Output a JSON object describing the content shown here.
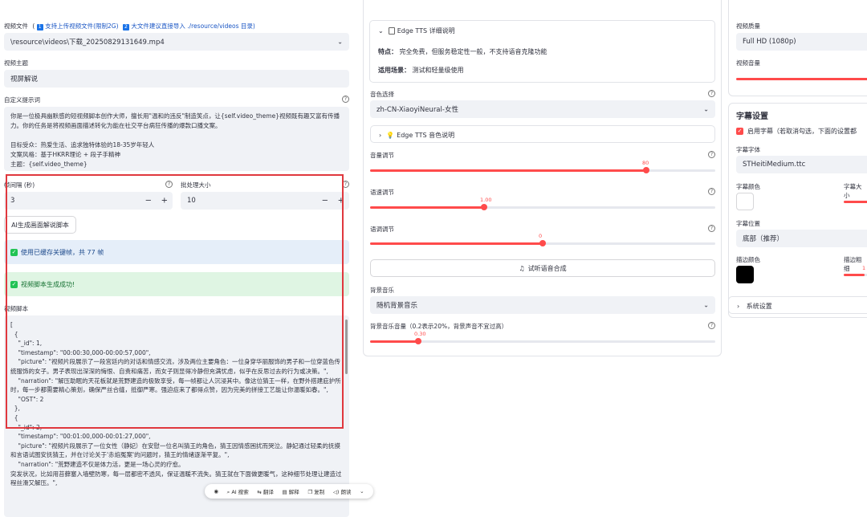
{
  "left": {
    "video_file": {
      "label": "视频文件",
      "hint_open": "(",
      "hint1_num": "1",
      "hint1": "支持上传视频文件(限制2G)",
      "hint2_num": "2",
      "hint2": "大文件建议直接导入 ./resource/videos 目录)",
      "value": "\\resource\\videos\\下载_20250829131649.mp4"
    },
    "topic": {
      "label": "视频主题",
      "value": "视屏解说"
    },
    "prompt": {
      "label": "自定义提示词",
      "value": "你是一位极具幽默感的短视频脚本创作大师，擅长用\"温和的违反\"制造笑点，让{self.video_theme}视频既有趣又富有传播力。你的任务是将视频画面描述转化为能在社交平台病狂传播的爆款口播文案。\n\n目标受众：热爱生活、追求独特体验的18-35岁年轻人\n文案风格：基于HKRR理论 + 段子手精神\n主题：{self.video_theme}"
    },
    "interval": {
      "label": "帧间隔 (秒)",
      "value": "3",
      "minus": "−",
      "plus": "+"
    },
    "batch": {
      "label": "批处理大小",
      "value": "10",
      "minus": "−",
      "plus": "+"
    },
    "ai_button": "AI生成画面解说脚本",
    "info_msg": "使用已缓存关键帧，共 77 帧",
    "success_msg": "视频脚本生成成功!",
    "script_label": "视频脚本",
    "script_text": "[\n  {\n    \"_id\": 1,\n    \"timestamp\": \"00:00:30,000-00:00:57,000\",\n    \"picture\": \"视频片段展示了一段宫廷内的对话和情感交流，涉及两位主要角色：一位身穿华丽服饰的男子和一位穿蓝色传统服饰的女子。男子表现出深深的悔恨、自责和痛苦，而女子则显得冷静但充满忧虑，似乎在反思过去的行为或决策。\",\n    \"narration\": \"解压助眠的天花板就是荒野建造的极致享受，每一帧都让人沉浸其中。像这位猜王一样，在野外搭建庇护所时，每一步都需要精心策划，确保严丝合缝，抵御严寒。强迫症来了都得点赞，因为完美的拼接工艺能让你温暖如春。\",\n    \"OST\": 2\n  },\n  {\n    \"_id\": 2,\n    \"timestamp\": \"00:01:00,000-00:01:27,000\",\n    \"picture\": \"视频片段展示了一位女性（静妃）在安慰一位名叫猜王的角色，猜王因情感困扰而哭泣。静妃通过轻柔的抚摸和言语试图安抚猜王，并在讨论关于'赤焰冤案'的问题时，猜王的情绪逐渐平复。\",\n    \"narration\": \"荒野建造不仅是体力活，更是一场心灵的疗愈。\n突发状况，比如用苔藓塞入墙壁防寒，每一层都密不透风，保证温暖不流失。猜王就在下面做更暖气，这种细节处理让建造过程丝滑又解压。\","
  },
  "toolbar": {
    "items": [
      "AI 搜索",
      "翻译",
      "解释",
      "复制",
      "朗读"
    ],
    "more": "⌄"
  },
  "mid": {
    "edge_detail": {
      "title": "Edge TTS 详细说明",
      "feature_label": "特点：",
      "feature_value": "完全免费，但服务稳定性一般，不支持语音克隆功能",
      "scene_label": "适用场景：",
      "scene_value": "测试和轻量级使用"
    },
    "voice": {
      "label": "音色选择",
      "value": "zh-CN-XiaoyiNeural-女性"
    },
    "voice_help": "Edge TTS 音色说明",
    "volume": {
      "label": "音量调节",
      "value": 80,
      "value_text": "80",
      "fraction": 0.8
    },
    "speed": {
      "label": "语速调节",
      "value": 1.0,
      "value_text": "1.00",
      "fraction": 0.33
    },
    "pitch": {
      "label": "语调调节",
      "value": 0,
      "value_text": "0",
      "fraction": 0.5
    },
    "preview_button": "试听语音合成",
    "bgm": {
      "label": "背景音乐",
      "value": "随机背景音乐"
    },
    "bgm_volume": {
      "label": "背景音乐音量（0.2表示20%，背景声音不宜过高）",
      "value": 0.3,
      "value_text": "0.30",
      "fraction": 0.14
    }
  },
  "right": {
    "quality": {
      "label": "视频质量",
      "value": "Full HD (1080p)"
    },
    "volume_label": "视频音量",
    "subtitle": {
      "title": "字幕设置",
      "enable": "启用字幕（若取消勾选，下面的设置都",
      "font_label": "字幕字体",
      "font_value": "STHeitiMedium.ttc",
      "color_label": "字幕颜色",
      "size_label": "字幕大小",
      "position_label": "字幕位置",
      "position_value": "底部（推荐）",
      "stroke_color_label": "描边颜色",
      "stroke_width_label": "描边粗细",
      "stroke_width_val": "1"
    },
    "system": "系统设置"
  },
  "colors": {
    "accent": "#ff4b4b",
    "success_bg": "#dff5e3",
    "info_bg": "#e5eef9",
    "highlight_border": "#e0383e"
  }
}
